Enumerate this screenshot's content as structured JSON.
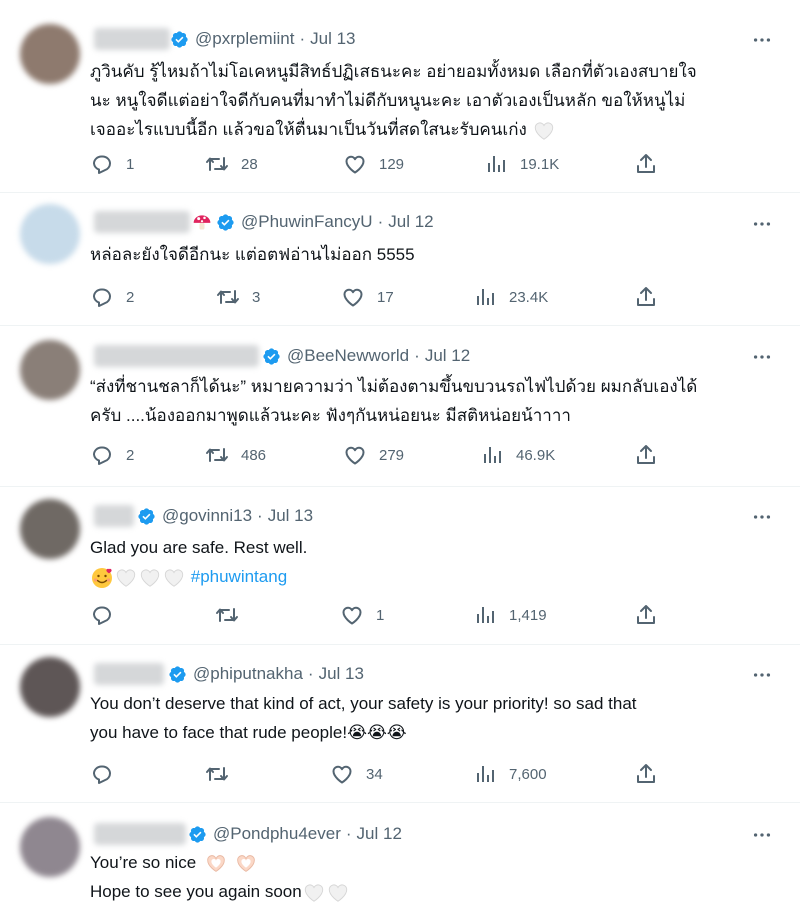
{
  "tweets": [
    {
      "handle": "@pxrplemiint",
      "sep": "·",
      "date": "Jul 13",
      "lines": [
        "ภูวินคับ รู้ไหมถ้าไม่โอเคหนูมีสิทธ์ปฏิเสธนะคะ อย่ายอมทั้งหมด เลือกที่ตัวเองสบายใจ",
        "นะ หนูใจดีแต่อย่าใจดีกับคนที่มาทำไม่ดีกับหนูนะคะ เอาตัวเองเป็นหลัก ขอให้หนูไม่",
        "เจออะไรแบบนี้อีก แล้วขอให้ตื่นมาเป็นวันที่สดใสนะรับคนเก่ง"
      ],
      "replies": "1",
      "retweets": "28",
      "likes": "129",
      "views": "19.1K"
    },
    {
      "handle": "@PhuwinFancyU",
      "sep": "·",
      "date": "Jul 12",
      "lines": [
        "หล่อละยังใจดีอีกนะ แต่อตฟอ่านไม่ออก 5555"
      ],
      "replies": "2",
      "retweets": "3",
      "likes": "17",
      "views": "23.4K"
    },
    {
      "handle": "@BeeNewworld",
      "sep": "·",
      "date": "Jul 12",
      "lines": [
        "“ส่งที่ชานชลาก็ได้นะ” หมายความว่า ไม่ต้องตามขึ้นขบวนรถไฟไปด้วย ผมกลับเองได้",
        "ครับ ....น้องออกมาพูดแล้วนะคะ ฟังๆกันหน่อยนะ มีสติหน่อยน้าาาา"
      ],
      "replies": "2",
      "retweets": "486",
      "likes": "279",
      "views": "46.9K"
    },
    {
      "handle": "@govinni13",
      "sep": "·",
      "date": "Jul 13",
      "lines": [
        "Glad you are safe. Rest well."
      ],
      "hashtag": "#phuwintang",
      "replies": "",
      "retweets": "",
      "likes": "1",
      "views": "1,419"
    },
    {
      "handle": "@phiputnakha",
      "sep": "·",
      "date": "Jul 13",
      "lines": [
        "You don’t deserve that kind of act, your safety is your priority! so sad that",
        "you have to face that rude people!😭😭😭"
      ],
      "replies": "",
      "retweets": "",
      "likes": "34",
      "views": "7,600"
    },
    {
      "handle": "@Pondphu4ever",
      "sep": "·",
      "date": "Jul 12",
      "lines": [
        "You’re so nice",
        "Hope to see you again soon"
      ]
    }
  ],
  "icons": {
    "verified": "verified-badge-icon",
    "reply": "reply-icon",
    "retweet": "retweet-icon",
    "like": "heart-icon",
    "views": "views-icon",
    "share": "share-icon",
    "more": "more-options-icon"
  },
  "colors": {
    "verified": "#1d9bf0",
    "text": "#0f1419",
    "muted": "#536471",
    "hashtag": "#1d9bf0"
  }
}
